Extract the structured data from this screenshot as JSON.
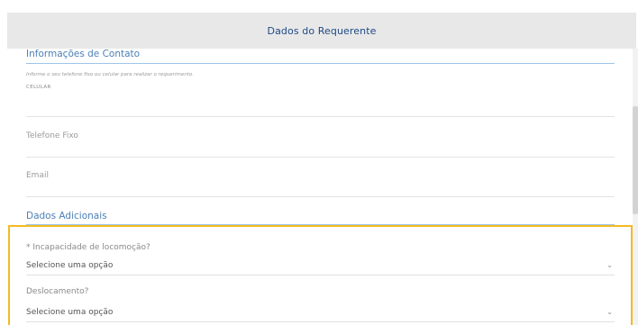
{
  "header": {
    "title": "Dados do Requerente"
  },
  "contact": {
    "title": "Informações de Contato",
    "hint": "Informe o seu telefone fixo ou celular para realizar o requerimento.",
    "cell_label": "CELULAR",
    "phone_label": "Telefone Fixo",
    "email_label": "Email"
  },
  "additional": {
    "title": "Dados Adicionais",
    "q1": {
      "label": "* Incapacidade de locomoção?",
      "value": "Selecione uma opção"
    },
    "q2": {
      "label": "Deslocamento?",
      "value": "Selecione uma opção"
    }
  },
  "icons": {
    "chevron": "⌄",
    "chevron_name": "chevron-down-icon"
  },
  "colors": {
    "header_bg": "#e8e8e8",
    "section_title": "#4b7fb5",
    "highlight": "#f3bb22"
  }
}
